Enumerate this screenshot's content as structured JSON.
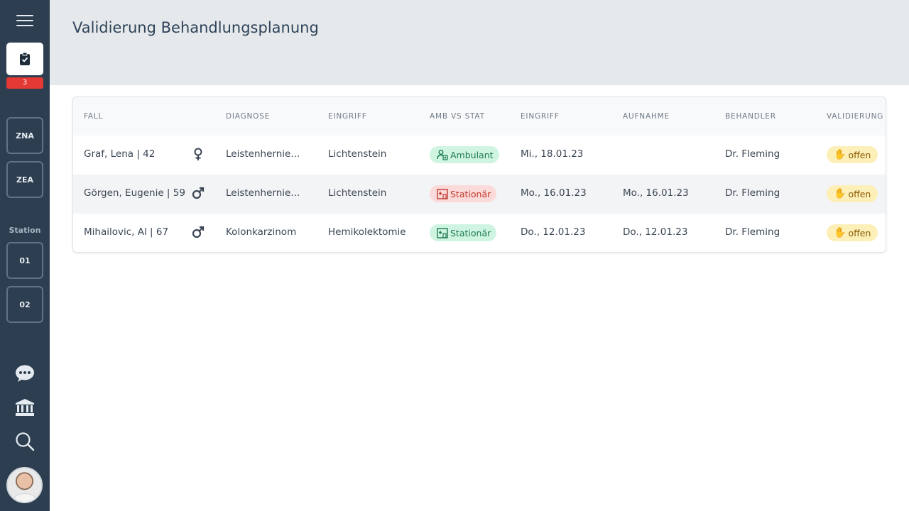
{
  "sidebar": {
    "badge_count": "3",
    "tiles_top": [
      "ZNA",
      "ZEA"
    ],
    "station_label": "Station",
    "station_tiles": [
      "01",
      "02"
    ],
    "icons": [
      "menu-icon",
      "clipboard-check-icon",
      "chat-icon",
      "institution-icon",
      "search-icon",
      "avatar"
    ]
  },
  "header": {
    "title": "Validierung Behandlungsplanung"
  },
  "table": {
    "columns": [
      "FALL",
      "DIAGNOSE",
      "EINGRIFF",
      "AMB VS STAT",
      "EINGRIFF",
      "AUFNAHME",
      "BEHANDLER",
      "VALIDIERUNG"
    ],
    "rows": [
      {
        "fall": "Graf, Lena | 42",
        "gender": "female-icon",
        "diagnose": "Leistenhernie...",
        "eingriff": "Lichtenstein",
        "amb_stat": "Ambulant",
        "amb_stat_type": "ambulant",
        "eingriff_datum": "Mi., 18.01.23",
        "aufnahme": "",
        "behandler": "Dr. Fleming",
        "validierung": "offen"
      },
      {
        "fall": "Görgen, Eugenie | 59",
        "gender": "male-icon",
        "diagnose": "Leistenhernie...",
        "eingriff": "Lichtenstein",
        "amb_stat": "Stationär",
        "amb_stat_type": "stationaer-red",
        "eingriff_datum": "Mo., 16.01.23",
        "aufnahme": "Mo., 16.01.23",
        "behandler": "Dr. Fleming",
        "validierung": "offen"
      },
      {
        "fall": "Mihailovic, Al | 67",
        "gender": "male-icon",
        "diagnose": "Kolonkarzinom",
        "eingriff": "Hemikolektomie",
        "amb_stat": "Stationär",
        "amb_stat_type": "stationaer-green",
        "eingriff_datum": "Do., 12.01.23",
        "aufnahme": "Do., 12.01.23",
        "behandler": "Dr. Fleming",
        "validierung": "offen"
      }
    ]
  },
  "colors": {
    "sidebar_bg": "#2c3e50",
    "header_bg": "#e6e9ec",
    "badge_red": "#e53935",
    "ambulant_green": "#1f7a4f",
    "stationaer_red": "#c0392b",
    "offen_yellow": "#fdefb8"
  }
}
